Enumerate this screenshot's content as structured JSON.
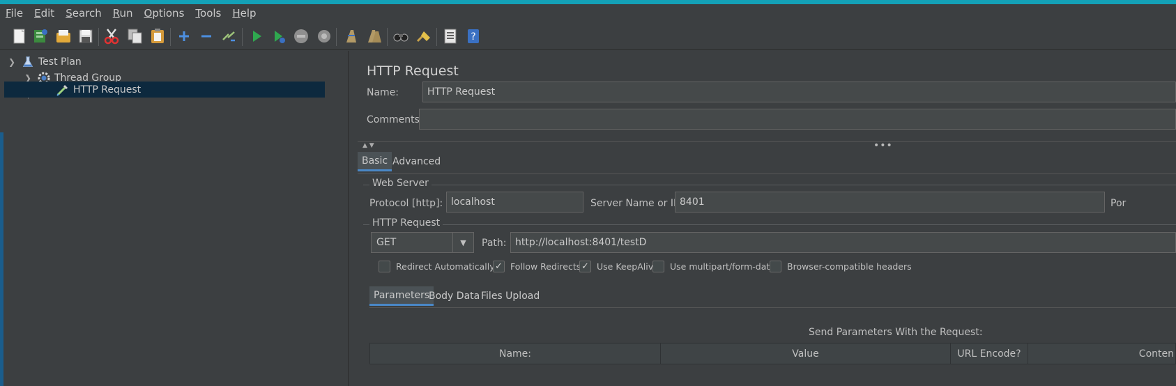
{
  "menu": [
    {
      "mnemonic": "F",
      "rest": "ile"
    },
    {
      "mnemonic": "E",
      "rest": "dit"
    },
    {
      "mnemonic": "S",
      "rest": "earch"
    },
    {
      "mnemonic": "R",
      "rest": "un"
    },
    {
      "mnemonic": "O",
      "rest": "ptions"
    },
    {
      "mnemonic": "T",
      "rest": "ools"
    },
    {
      "mnemonic": "H",
      "rest": "elp"
    }
  ],
  "toolbar": {
    "icons": [
      "new-icon",
      "templates-icon",
      "open-icon",
      "save-icon",
      "cut-icon",
      "copy-icon",
      "paste-icon",
      "expand-icon",
      "collapse-icon",
      "toggle-icon",
      "start-icon",
      "start-no-pauses-icon",
      "stop-icon",
      "shutdown-icon",
      "clear-icon",
      "clear-all-icon",
      "search-icon",
      "reset-search-icon",
      "function-helper-icon",
      "help-icon"
    ]
  },
  "tree": {
    "items": [
      {
        "label": "Test Plan",
        "icon": "flask-icon"
      },
      {
        "label": "Thread Group",
        "icon": "gear-icon"
      },
      {
        "label": "HTTP Request",
        "icon": "pipette-icon"
      }
    ]
  },
  "panel": {
    "title": "HTTP Request",
    "name_label": "Name:",
    "name_value": "HTTP Request",
    "comments_label": "Comments:",
    "comments_value": "",
    "tabs": [
      "Basic",
      "Advanced"
    ],
    "web_server": {
      "title": "Web Server",
      "protocol_label": "Protocol [http]:",
      "protocol_value": "localhost",
      "server_label": "Server Name or IP:",
      "server_value": "8401",
      "port_label": "Por"
    },
    "http_request": {
      "title": "HTTP Request",
      "method": "GET",
      "path_label": "Path:",
      "path_value": "http://localhost:8401/testD",
      "checkboxes": [
        {
          "label": "Redirect Automatically",
          "checked": false
        },
        {
          "label": "Follow Redirects",
          "checked": true
        },
        {
          "label": "Use KeepAlive",
          "checked": true
        },
        {
          "label": "Use multipart/form-data",
          "checked": false
        },
        {
          "label": "Browser-compatible headers",
          "checked": false
        }
      ]
    },
    "sub_tabs": [
      "Parameters",
      "Body Data",
      "Files Upload"
    ],
    "params_title": "Send Parameters With the Request:",
    "columns": [
      "Name:",
      "Value",
      "URL Encode?",
      "Conten"
    ]
  },
  "colors": {
    "accent_strip": "#14a1b7",
    "selection": "#0d293e",
    "tab_underline": "#4a88c7"
  }
}
